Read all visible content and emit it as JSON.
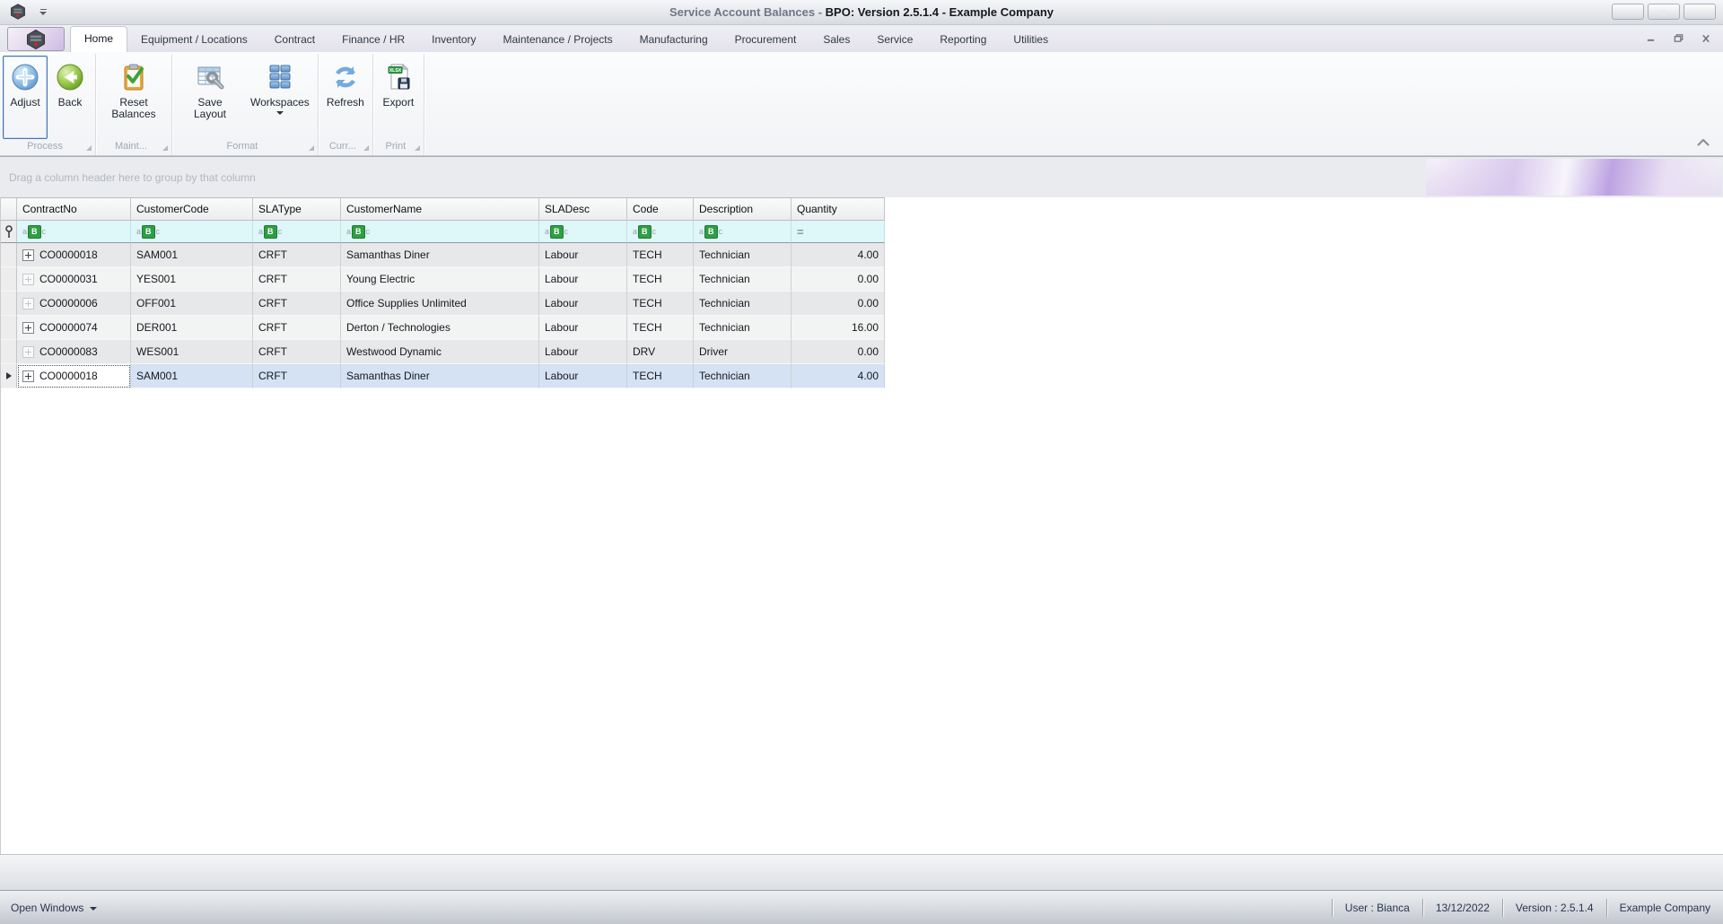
{
  "window": {
    "title_prefix": "Service Account Balances - ",
    "title_main": "BPO: Version 2.5.1.4 - Example Company"
  },
  "tabs": [
    "Home",
    "Equipment / Locations",
    "Contract",
    "Finance / HR",
    "Inventory",
    "Maintenance / Projects",
    "Manufacturing",
    "Procurement",
    "Sales",
    "Service",
    "Reporting",
    "Utilities"
  ],
  "ribbon": {
    "buttons": {
      "adjust": "Adjust",
      "back": "Back",
      "reset_balances": "Reset Balances",
      "save_layout": "Save Layout",
      "workspaces": "Workspaces",
      "refresh": "Refresh",
      "export": "Export"
    },
    "groups": {
      "process": "Process",
      "maint": "Maint...",
      "format": "Format",
      "curr": "Curr...",
      "print": "Print"
    }
  },
  "group_panel": {
    "hint": "Drag a column header here to group by that column"
  },
  "grid": {
    "columns": [
      "ContractNo",
      "CustomerCode",
      "SLAType",
      "CustomerName",
      "SLADesc",
      "Code",
      "Description",
      "Quantity"
    ],
    "filter": {
      "abc": [
        "a",
        "B",
        "c"
      ],
      "equals": "="
    },
    "rows": [
      {
        "ContractNo": "CO0000018",
        "CustomerCode": "SAM001",
        "SLAType": "CRFT",
        "CustomerName": "Samanthas Diner",
        "SLADesc": "Labour",
        "Code": "TECH",
        "Description": "Technician",
        "Quantity": "4.00"
      },
      {
        "ContractNo": "CO0000031",
        "CustomerCode": "YES001",
        "SLAType": "CRFT",
        "CustomerName": "Young Electric",
        "SLADesc": "Labour",
        "Code": "TECH",
        "Description": "Technician",
        "Quantity": "0.00"
      },
      {
        "ContractNo": "CO0000006",
        "CustomerCode": "OFF001",
        "SLAType": "CRFT",
        "CustomerName": "Office Supplies Unlimited",
        "SLADesc": "Labour",
        "Code": "TECH",
        "Description": "Technician",
        "Quantity": "0.00"
      },
      {
        "ContractNo": "CO0000074",
        "CustomerCode": "DER001",
        "SLAType": "CRFT",
        "CustomerName": "Derton / Technologies",
        "SLADesc": "Labour",
        "Code": "TECH",
        "Description": "Technician",
        "Quantity": "16.00"
      },
      {
        "ContractNo": "CO0000083",
        "CustomerCode": "WES001",
        "SLAType": "CRFT",
        "CustomerName": "Westwood Dynamic",
        "SLADesc": "Labour",
        "Code": "DRV",
        "Description": "Driver",
        "Quantity": "0.00"
      },
      {
        "ContractNo": "CO0000018",
        "CustomerCode": "SAM001",
        "SLAType": "CRFT",
        "CustomerName": "Samanthas Diner",
        "SLADesc": "Labour",
        "Code": "TECH",
        "Description": "Technician",
        "Quantity": "4.00"
      }
    ]
  },
  "status_bar": {
    "open_windows": "Open Windows",
    "user": "User : Bianca",
    "date": "13/12/2022",
    "version": "Version : 2.5.1.4",
    "company": "Example Company"
  },
  "colors": {
    "filter_icon_green": "#2f9e44",
    "selected_row_blue": "#d4e2f4",
    "filter_row_cyan": "#def7f8",
    "focus_border_blue": "#4374b7",
    "swoosh_purple": "#b292dd"
  }
}
